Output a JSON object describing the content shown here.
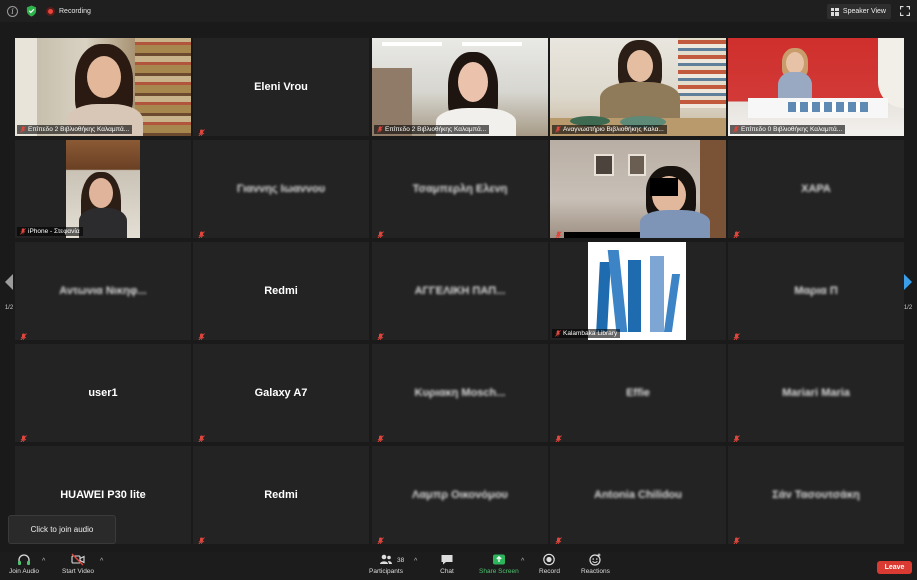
{
  "topbar": {
    "recording_label": "Recording",
    "view_label": "Speaker View"
  },
  "tiles": [
    {
      "id": "r1c1",
      "caption": "Επίπεδο 2 Βιβλιοθήκης Καλαμπά...",
      "video": true,
      "active": true
    },
    {
      "id": "r1c2",
      "name": "Eleni Vrou",
      "blur": false
    },
    {
      "id": "r1c3",
      "caption": "Επίπεδο 2 Βιβλιοθήκης Καλαμπά...",
      "video": true
    },
    {
      "id": "r1c4",
      "caption": "Αναγνωστήριο Βιβλιοθήκης Καλα...",
      "video": true
    },
    {
      "id": "r1c5",
      "caption": "Επίπεδο 0 Βιβλιοθήκης Καλαμπά...",
      "video": true
    },
    {
      "id": "r2c1",
      "caption": "iPhone - Στεφανία",
      "video": true
    },
    {
      "id": "r2c2",
      "name": "Γιαννης Ιωαννου",
      "blur": true
    },
    {
      "id": "r2c3",
      "name": "Τσαμπερλη Ελενη",
      "blur": true
    },
    {
      "id": "r2c4",
      "caption": "",
      "video": true
    },
    {
      "id": "r2c5",
      "name": "ΧΑΡΑ",
      "blur": true
    },
    {
      "id": "r3c1",
      "name": "Αντωνια Νικηφ...",
      "blur": true
    },
    {
      "id": "r3c2",
      "name": "Redmi",
      "blur": false
    },
    {
      "id": "r3c3",
      "name": "ΑΓΓΕΛΙΚΗ ΠΑΠ...",
      "blur": true
    },
    {
      "id": "r3c4",
      "caption": "Kalambaka Library",
      "video": true
    },
    {
      "id": "r3c5",
      "name": "Μαρια Π",
      "blur": true
    },
    {
      "id": "r4c1",
      "name": "user1",
      "blur": false
    },
    {
      "id": "r4c2",
      "name": "Galaxy A7",
      "blur": false
    },
    {
      "id": "r4c3",
      "name": "Κυριακη Mosch...",
      "blur": true
    },
    {
      "id": "r4c4",
      "name": "Effie",
      "blur": true
    },
    {
      "id": "r4c5",
      "name": "Mariari Maria",
      "blur": true
    },
    {
      "id": "r5c1",
      "name": "HUAWEI P30 lite",
      "blur": false
    },
    {
      "id": "r5c2",
      "name": "Redmi",
      "blur": false
    },
    {
      "id": "r5c3",
      "name": "Λαμπρ Οικονόμου",
      "blur": true
    },
    {
      "id": "r5c4",
      "name": "Antonia Chilidou",
      "blur": true
    },
    {
      "id": "r5c5",
      "name": "Σάν Τασουτσάκη",
      "blur": true
    }
  ],
  "pagination": {
    "left": "1/2",
    "right": "1/2"
  },
  "tooltip": "Click to join audio",
  "toolbar": {
    "join_audio": "Join Audio",
    "start_video": "Start Video",
    "participants": "Participants",
    "participants_count": "38",
    "chat": "Chat",
    "share_screen": "Share Screen",
    "record": "Record",
    "reactions": "Reactions",
    "leave": "Leave"
  },
  "colors": {
    "active_border": "#d8d67a",
    "share_green": "#4ec36f",
    "leave_red": "#d93a31",
    "recording_red": "#e8453c"
  }
}
